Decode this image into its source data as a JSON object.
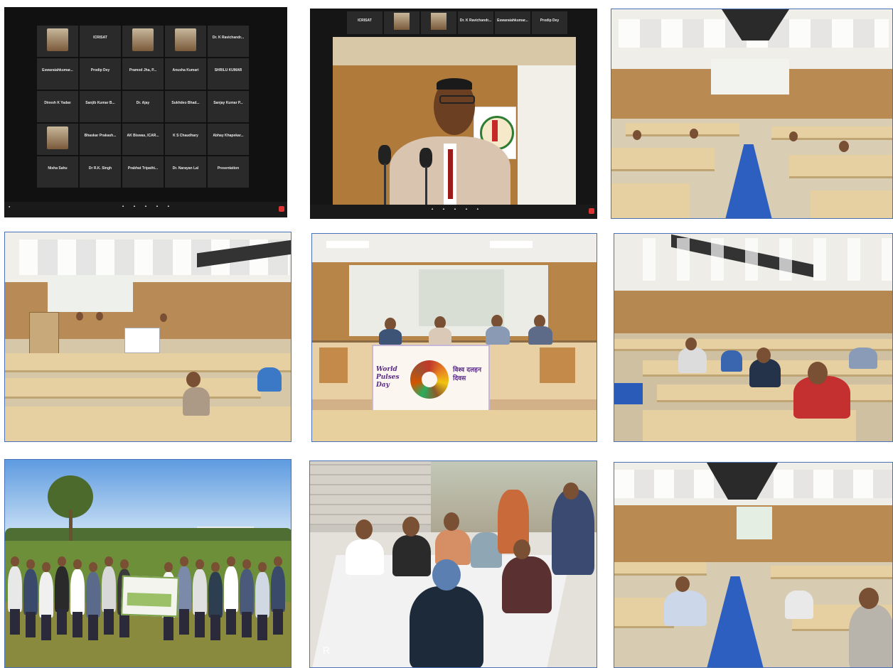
{
  "photos": [
    {
      "id": "p1",
      "type": "zoom-gallery",
      "participants": [
        "",
        "ICRISAT",
        "",
        "",
        "Dr. K Ravichandr...",
        "Eswaraiahkumar...",
        "Prodip Dey",
        "Pramod Jha, P...",
        "Anusha Kumari",
        "SHRILU KUMAR",
        "Dinesh K Yadav",
        "Sanjib Kumar B...",
        "Dr. Ajay",
        "Sukhdeo Bhad...",
        "Sanjay Kumar P...",
        "",
        "Bhaskar Prakash...",
        "AK Biswas, ICAR...",
        "K S Chaudhary",
        "Abhay Khapekar...",
        "Nisha Sahu",
        "Dr R.K. Singh",
        "Prabhat Tripathi...",
        "Dr. Narayan Lal",
        "Presentation"
      ]
    },
    {
      "id": "p2",
      "type": "zoom-speaker",
      "top_names": [
        "ICRISAT",
        "",
        "",
        "Dr. K Ravichandr...",
        "Eswaraiahkumar...",
        "Prodip Dey"
      ]
    },
    {
      "id": "p3",
      "type": "auditorium-aisle"
    },
    {
      "id": "p4",
      "type": "auditorium-podium"
    },
    {
      "id": "p5",
      "type": "dais-banner",
      "banner_left": "World Pulses Day",
      "banner_right": "विश्व दलहन दिवस"
    },
    {
      "id": "p6",
      "type": "auditorium-audience"
    },
    {
      "id": "p7",
      "type": "field-group"
    },
    {
      "id": "p8",
      "type": "farmer-meeting"
    },
    {
      "id": "p9",
      "type": "auditorium-aisle-2"
    }
  ]
}
